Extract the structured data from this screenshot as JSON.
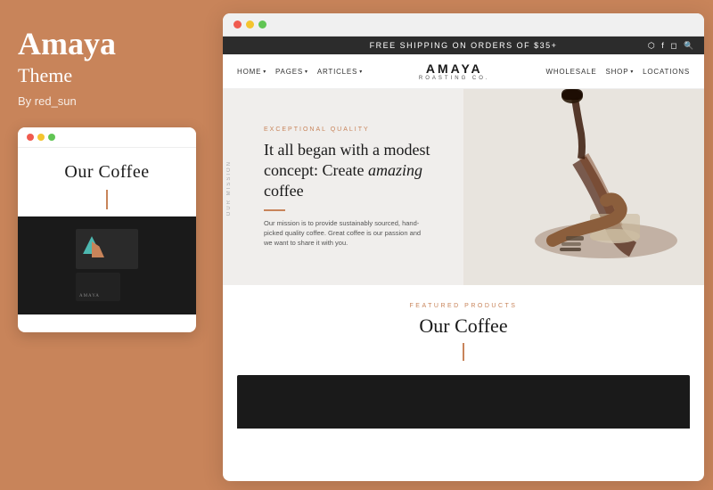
{
  "left": {
    "theme_name": "Amaya",
    "theme_label": "Theme",
    "author_label": "By red_sun",
    "mini": {
      "our_coffee": "Our Coffee"
    }
  },
  "browser": {
    "announcement": "FREE SHIPPING ON ORDERS OF $35+",
    "nav": {
      "home": "HOME",
      "pages": "PAGES",
      "articles": "ARTICLES",
      "logo_title": "AMAYA",
      "logo_sub": "ROASTING CO.",
      "wholesale": "WHOLESALE",
      "shop": "SHOP",
      "locations": "LOCATIONS"
    },
    "hero": {
      "tag": "EXCEPTIONAL QUALITY",
      "heading_1": "It all began with a modest concept: Create",
      "heading_em": "amazing",
      "heading_2": "coffee",
      "mission_label": "OUR MISSION",
      "body_text": "Our mission is to provide sustainably sourced, hand-picked quality coffee. Great coffee is our passion and we want to share it with you."
    },
    "featured": {
      "label": "FEATURED PRODUCTS",
      "title": "Our Coffee"
    }
  },
  "dots": {
    "red": "#f05b4f",
    "yellow": "#f4c430",
    "green": "#61c554"
  },
  "colors": {
    "accent": "#c8845a",
    "dark": "#1a1a1a",
    "bg": "#c8845a"
  }
}
